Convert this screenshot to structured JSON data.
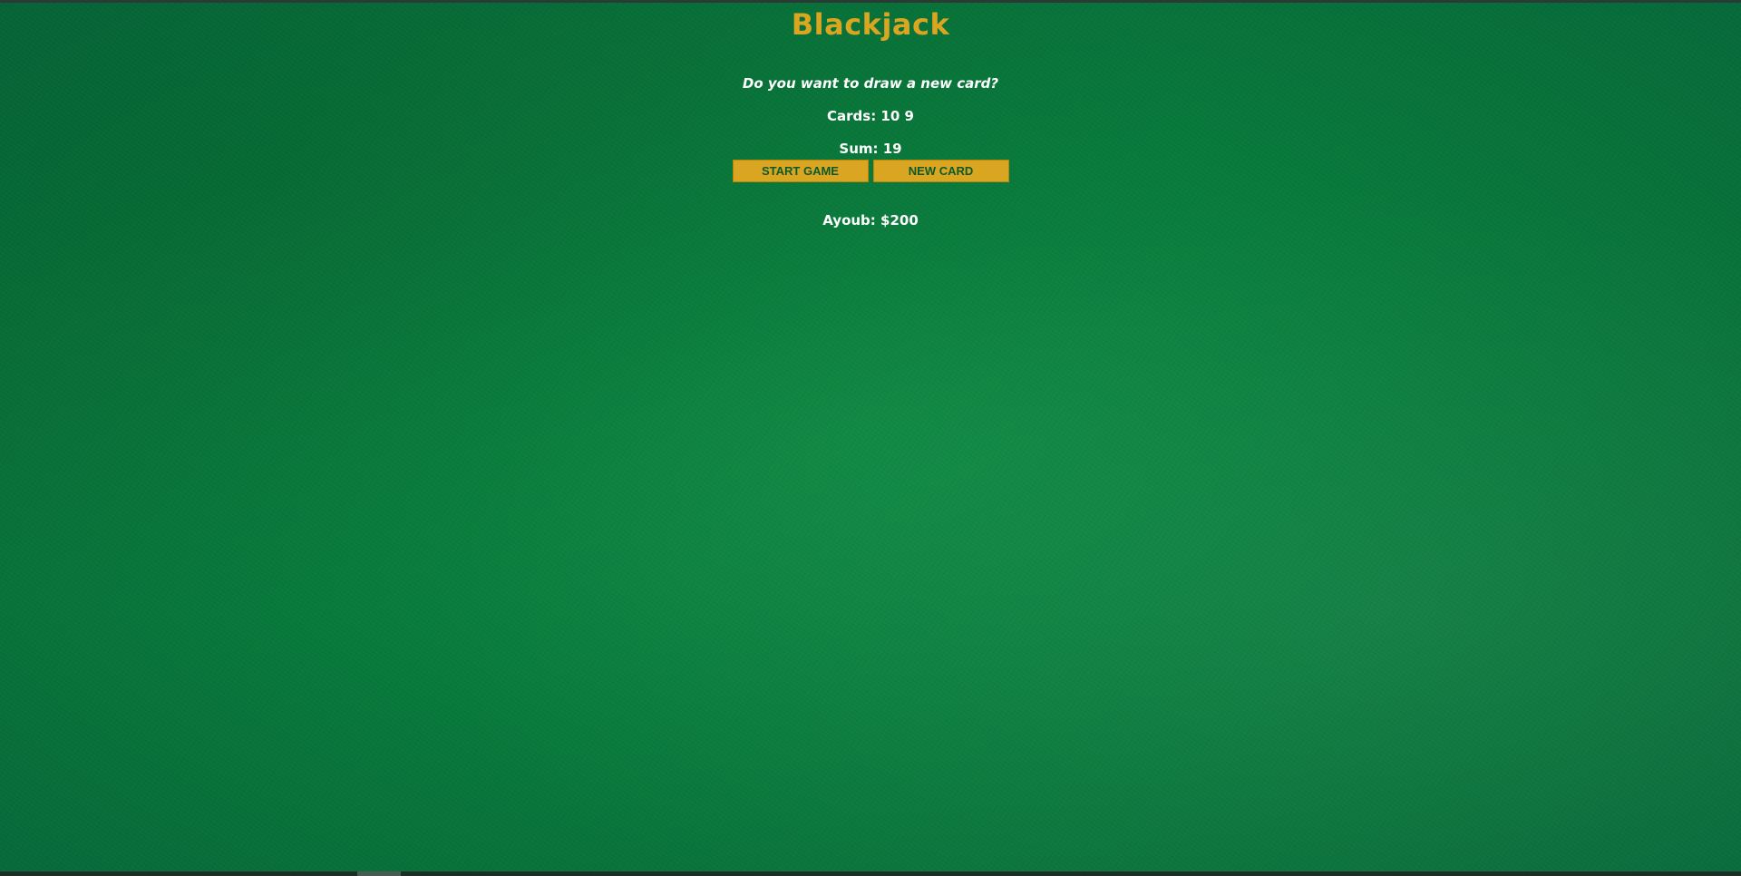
{
  "title": "Blackjack",
  "message": "Do you want to draw a new card?",
  "cards": "Cards: 10 9",
  "sum": "Sum: 19",
  "buttons": {
    "start": "START GAME",
    "new_card": "NEW CARD"
  },
  "player": "Ayoub: $200",
  "colors": {
    "felt": "#0a7a3c",
    "accent": "#daa520",
    "button_text": "#0c5a2a",
    "text": "#ffffff"
  }
}
